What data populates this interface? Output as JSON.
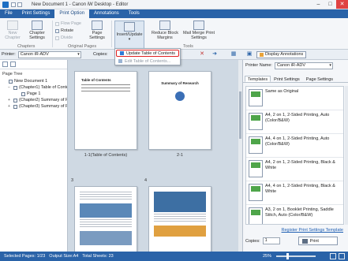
{
  "window": {
    "title": "New Document 1 - Canon iW Desktop - Editor"
  },
  "tabs": [
    "File",
    "Print Settings",
    "Print Option",
    "Annotations",
    "Tools"
  ],
  "ribbon": {
    "new_chapter": "New Chapter",
    "chapter_settings": "Chapter Settings",
    "group_chapters": "Chapters",
    "flow_page": "Flow Page",
    "rotate": "Rotate",
    "divide": "Divide",
    "page_settings": "Page Settings",
    "group_original_pages": "Original Pages",
    "insert_update": "Insert/Update",
    "reduce_block_margins": "Reduce Block Margins",
    "mail_merge_print_settings": "Mail Merge Print Settings",
    "group_tools": "Tools"
  },
  "dropdown": {
    "update_toc": "Update Table of Contents",
    "edit_toc": "Edit Table of Contents..."
  },
  "toolbar": {
    "printer_label": "Printer:",
    "printer_value": "Canon iR-ADV",
    "copies_label": "Copies:",
    "display_annotations": "Display Annotations"
  },
  "left_pane": {
    "title": "Page Tree",
    "items": [
      {
        "label": "New Document 1",
        "toggle": ""
      },
      {
        "label": "(Chapter1) Table of Conte",
        "toggle": "−"
      },
      {
        "label": "Page 1",
        "toggle": ""
      },
      {
        "label": "(Chapter2) Summary of R",
        "toggle": "+"
      },
      {
        "label": "(Chapter3) Summary of R",
        "toggle": "+"
      }
    ]
  },
  "workspace": {
    "page1_title": "Table of Contents",
    "page2_title": "Summary of Research",
    "label_1": "1-1(Table of Contents)",
    "label_2": "2-1",
    "num_3": "3",
    "num_4": "4"
  },
  "right_pane": {
    "printer_label": "Printer Name:",
    "printer_value": "Canon iR-ADV",
    "tabs": [
      "Templates",
      "Print Settings",
      "Page Settings"
    ],
    "templates": [
      "Same as Original",
      "A4, 2 on 1, 2-Sided Printing, Auto (Color/B&W)",
      "A4, 4 on 1, 2-Sided Printing, Auto (Color/B&W)",
      "A4, 2 on 1, 2-Sided Printing, Black & White",
      "A4, 4 on 1, 2-Sided Printing, Black & White",
      "A3, 2 on 1, Booklet Printing, Saddle Stitch, Auto (Color/B&W)"
    ],
    "register_link": "Register Print Settings Template",
    "copies_label": "Copies:",
    "copies_value": "1",
    "print_button": "Print"
  },
  "status": {
    "selected": "Selected Pages: 1/23",
    "output_size": "Output Size:A4",
    "total_sheets": "Total Sheets: 23",
    "zoom": "25%",
    "zoom_level": 0.25
  },
  "colors": {
    "accent": "#2a63a8",
    "highlight": "#e02020"
  }
}
